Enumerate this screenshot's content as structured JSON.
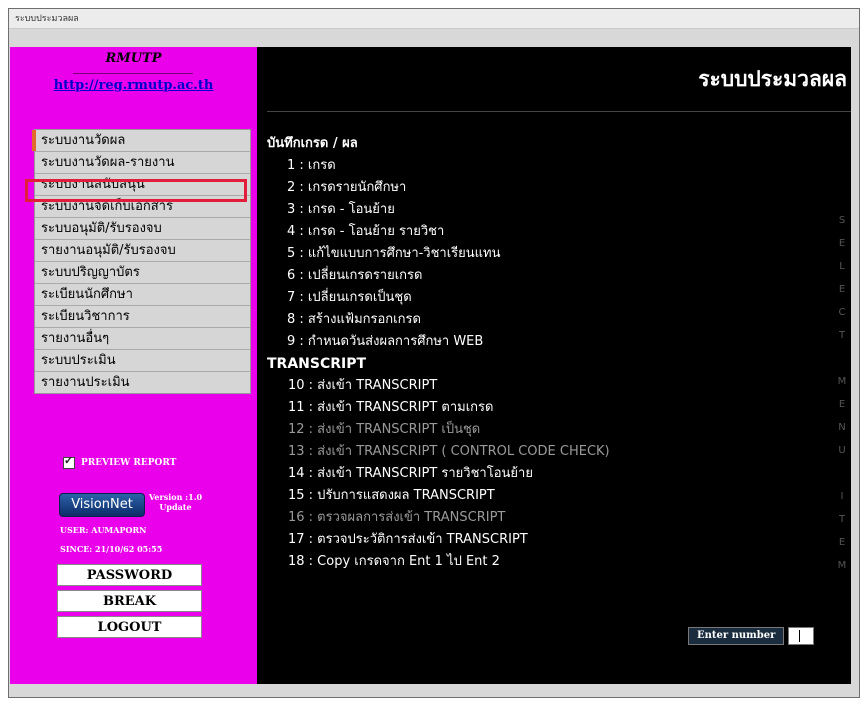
{
  "window": {
    "title": "ระบบประมวลผล"
  },
  "sidebar": {
    "logo": "RMUTP",
    "url": "http://reg.rmutp.ac.th",
    "menu": [
      {
        "label": "ระบบงานวัดผล"
      },
      {
        "label": "ระบบงานวัดผล-รายงาน"
      },
      {
        "label": "ระบบงานสนับสนุน"
      },
      {
        "label": "ระบบงานจัดเก็บเอกสาร"
      },
      {
        "label": "ระบบอนุมัติ/รับรองจบ"
      },
      {
        "label": "รายงานอนุมัติ/รับรองจบ"
      },
      {
        "label": "ระบบปริญญาบัตร"
      },
      {
        "label": "ระเบียนนักศึกษา"
      },
      {
        "label": "ระเบียนวิชาการ"
      },
      {
        "label": "รายงานอื่นๆ"
      },
      {
        "label": "ระบบประเมิน"
      },
      {
        "label": "รายงานประเมิน"
      }
    ],
    "highlight_color": "#e11d3b",
    "preview": {
      "label": "PREVIEW REPORT",
      "checked": true
    },
    "vision": {
      "logo": "VisionNet",
      "version": "Version :1.0",
      "update": "Update"
    },
    "user": "USER: AUMAPORN",
    "since": "SINCE: 21/10/62 05:55",
    "buttons": {
      "password": "PASSWORD",
      "break": "BREAK",
      "logout": "LOGOUT"
    }
  },
  "main": {
    "title": "ระบบประมวลผล",
    "section1": "บันทึกเกรด / ผล",
    "items1": [
      {
        "text": "1 : เกรด"
      },
      {
        "text": "2 : เกรดรายนักศึกษา"
      },
      {
        "text": "3 : เกรด - โอนย้าย"
      },
      {
        "text": "4 : เกรด - โอนย้าย รายวิชา"
      },
      {
        "text": "5 : แก้ไขแบบการศึกษา-วิชาเรียนแทน"
      },
      {
        "text": "6 : เปลี่ยนเกรดรายเกรด"
      },
      {
        "text": "7 : เปลี่ยนเกรดเป็นชุด"
      },
      {
        "text": "8 : สร้างแฟ้มกรอกเกรด"
      },
      {
        "text": "9 : กำหนดวันส่งผลการศึกษา WEB"
      }
    ],
    "section2": "TRANSCRIPT",
    "items2": [
      {
        "text": "10 : ส่งเข้า TRANSCRIPT"
      },
      {
        "text": "11 : ส่งเข้า TRANSCRIPT ตามเกรด"
      },
      {
        "text": "12 : ส่งเข้า TRANSCRIPT เป็นชุด"
      },
      {
        "text": "13 : ส่งเข้า TRANSCRIPT ( CONTROL CODE CHECK)"
      },
      {
        "text": "14 : ส่งเข้า TRANSCRIPT รายวิชาโอนย้าย"
      },
      {
        "text": "15 : ปรับการแสดงผล TRANSCRIPT"
      },
      {
        "text": "16 : ตรวจผลการส่งเข้า TRANSCRIPT"
      },
      {
        "text": "17 : ตรวจประวัติการส่งเข้า TRANSCRIPT"
      },
      {
        "text": "18 : Copy เกรดจาก Ent 1 ไป Ent 2"
      }
    ],
    "vertical_letters": [
      "S",
      "E",
      "L",
      "E",
      "C",
      "T",
      "",
      "M",
      "E",
      "N",
      "U",
      "",
      "I",
      "T",
      "E",
      "M"
    ],
    "enter_label": "Enter number"
  }
}
